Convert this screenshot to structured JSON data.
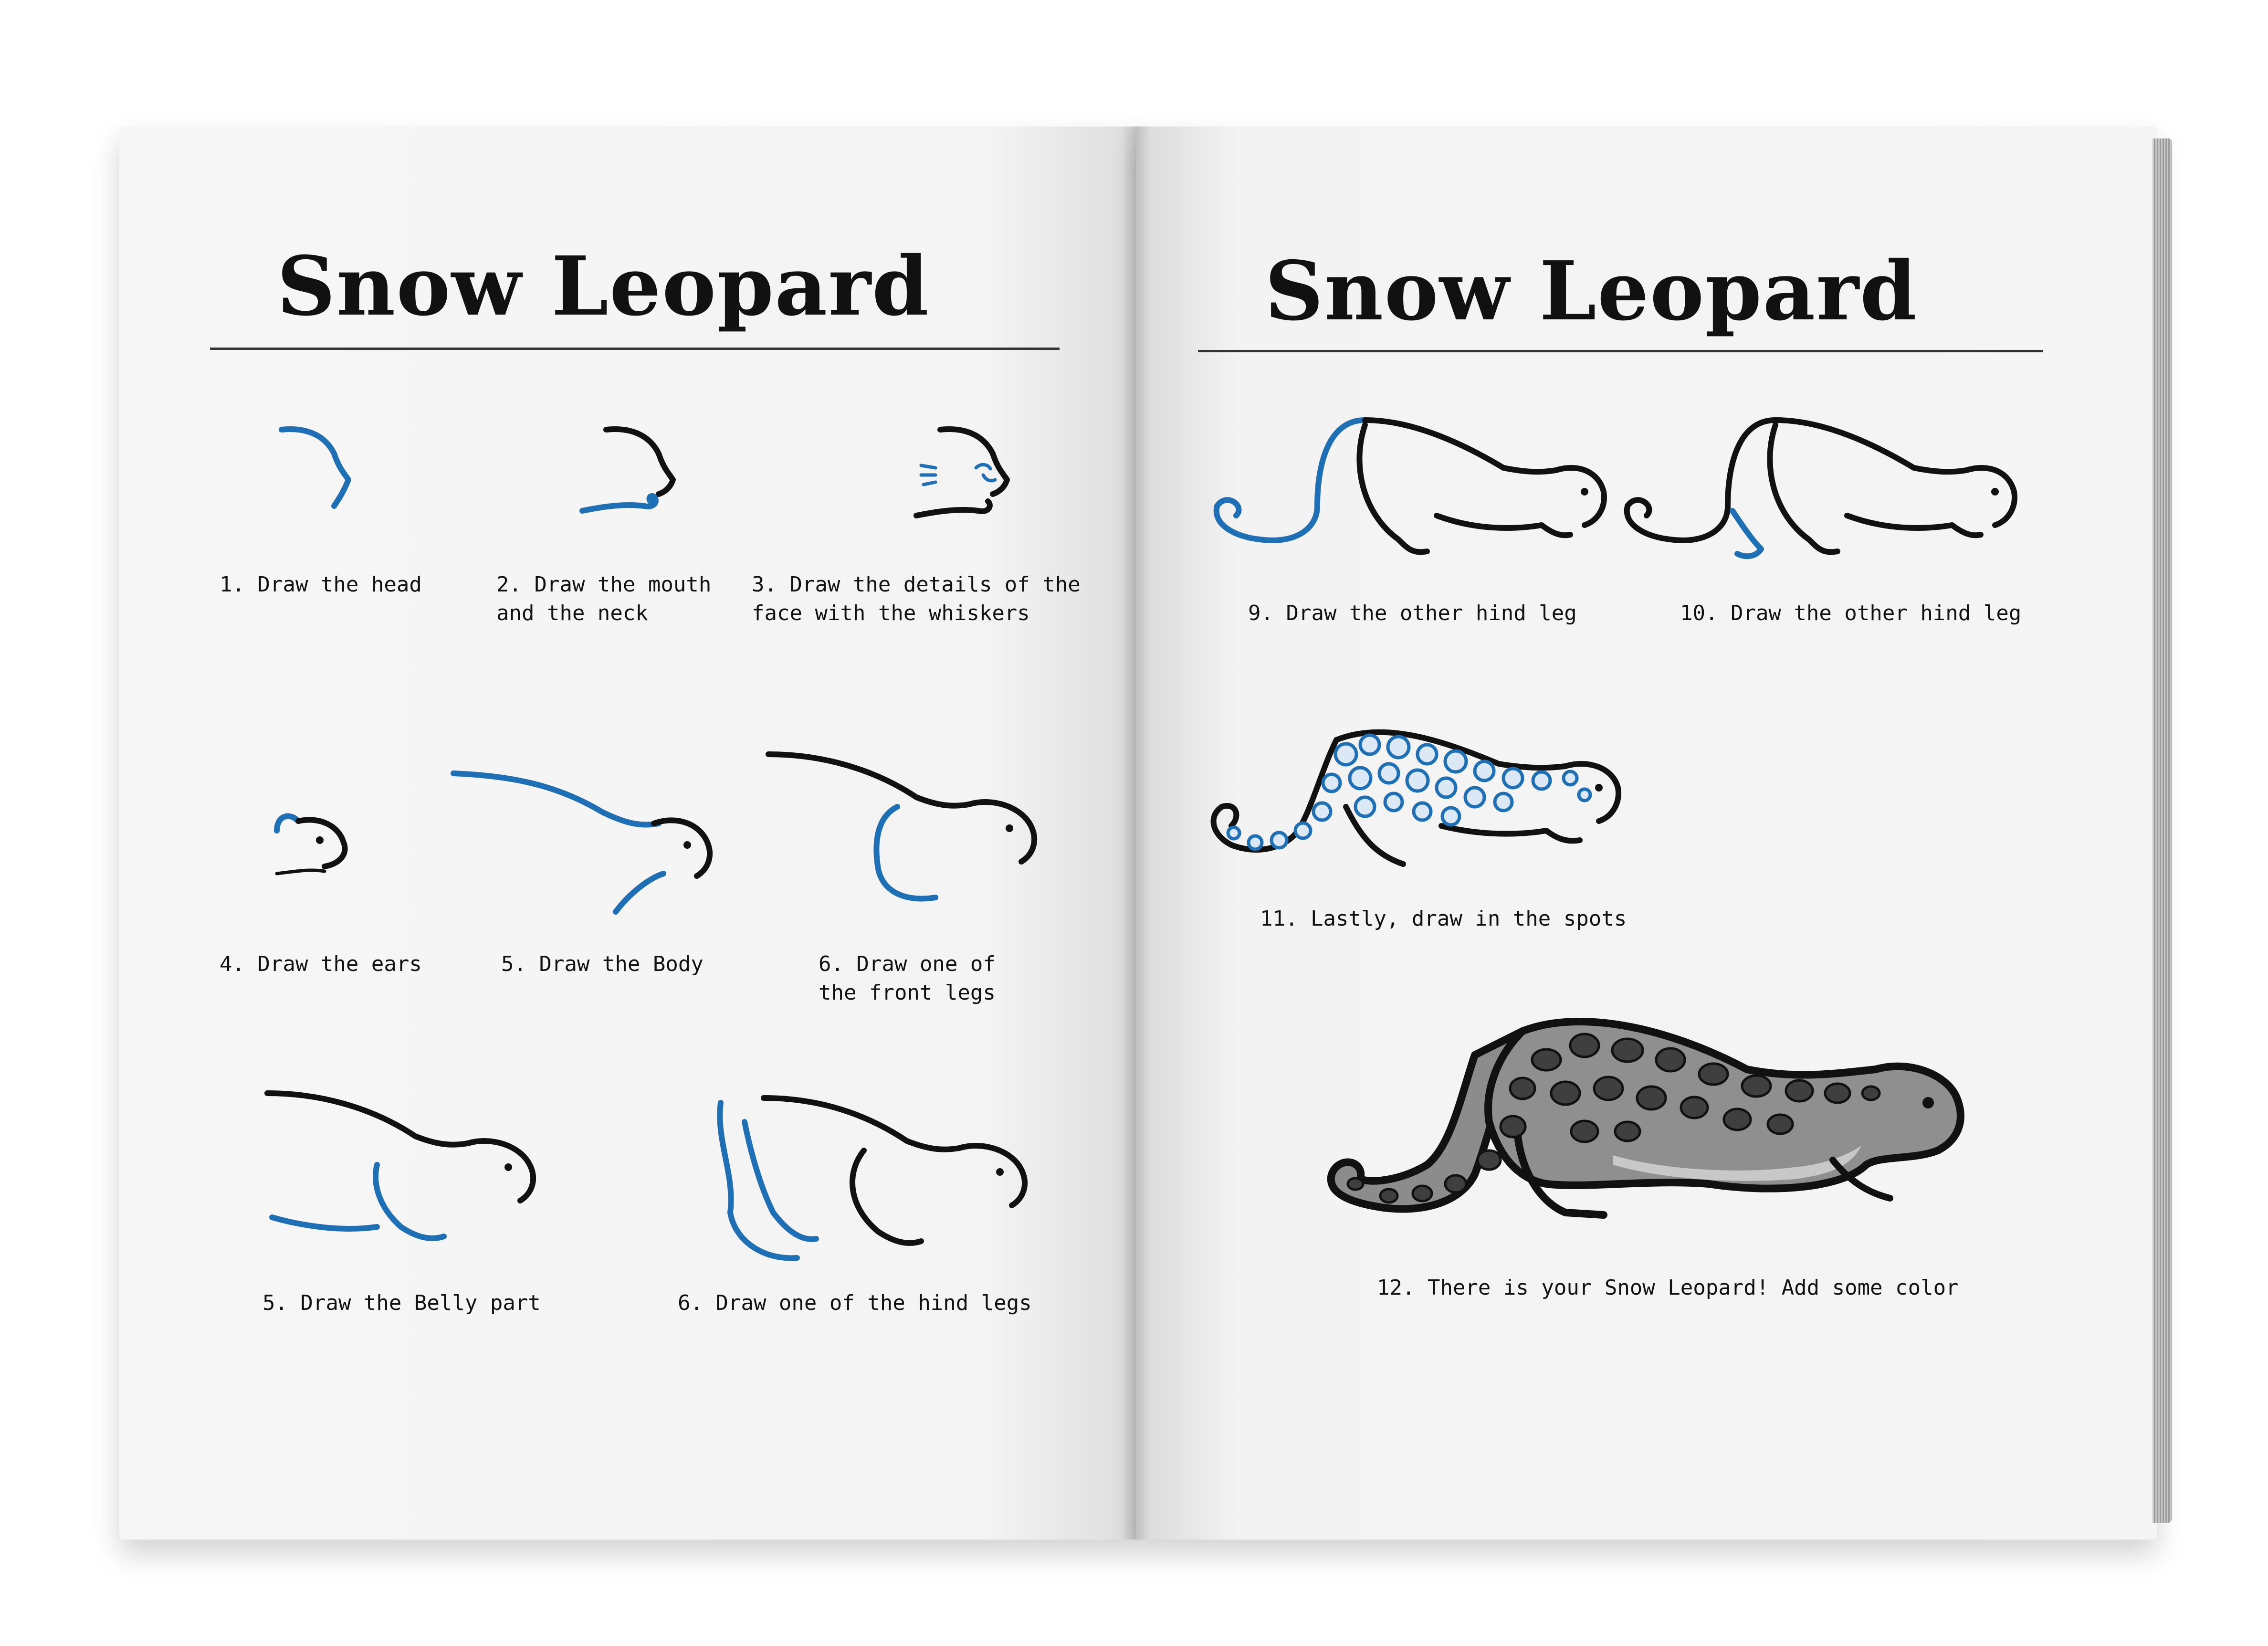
{
  "left_page": {
    "title": "Snow Leopard",
    "steps": [
      {
        "label": "1. Draw the head"
      },
      {
        "label": "2. Draw the mouth\nand the neck"
      },
      {
        "label": "3. Draw the details of the\nface with the whiskers"
      },
      {
        "label": "4. Draw the ears"
      },
      {
        "label": "5. Draw the Body"
      },
      {
        "label": "6. Draw one of\nthe front legs"
      },
      {
        "label": "5. Draw the Belly part"
      },
      {
        "label": "6. Draw one of the hind legs"
      }
    ]
  },
  "right_page": {
    "title": "Snow Leopard",
    "steps": [
      {
        "label": "9. Draw the other hind leg"
      },
      {
        "label": "10. Draw the other hind leg"
      },
      {
        "label": "11. Lastly, draw in the spots"
      },
      {
        "label": "12. There is your Snow Leopard! Add some color"
      }
    ]
  },
  "colors": {
    "ink": "#111111",
    "highlight": "#1f6fb5",
    "fur_gray": "#8c8c8c",
    "spot_dark": "#3f3f3f"
  }
}
